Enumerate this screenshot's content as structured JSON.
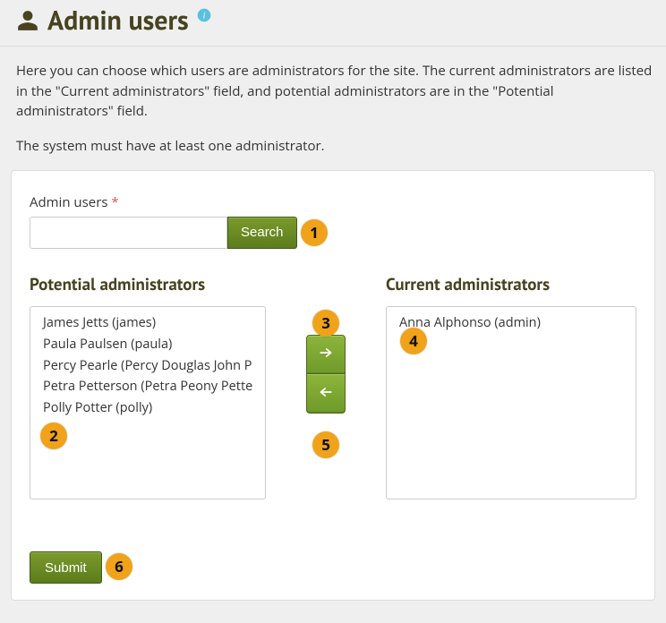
{
  "header": {
    "title": "Admin users"
  },
  "intro": {
    "p1": "Here you can choose which users are administrators for the site. The current administrators are listed in the \"Current administrators\" field, and potential administrators are in the \"Potential administrators\" field.",
    "p2": "The system must have at least one administrator."
  },
  "search": {
    "label": "Admin users",
    "required": "*",
    "value": "",
    "button": "Search"
  },
  "columns": {
    "potential_title": "Potential administrators",
    "current_title": "Current administrators"
  },
  "potential": [
    "James Jetts (james)",
    "Paula Paulsen (paula)",
    "Percy Pearle (Percy Douglas John P",
    "Petra Petterson (Petra Peony Pette",
    "Polly Potter (polly)"
  ],
  "current": [
    "Anna Alphonso (admin)"
  ],
  "submit": {
    "label": "Submit"
  },
  "callouts": {
    "1": "1",
    "2": "2",
    "3": "3",
    "4": "4",
    "5": "5",
    "6": "6"
  },
  "colors": {
    "accent_green": "#6f9a2b",
    "callout_orange": "#f0a31a",
    "heading": "#474220"
  }
}
